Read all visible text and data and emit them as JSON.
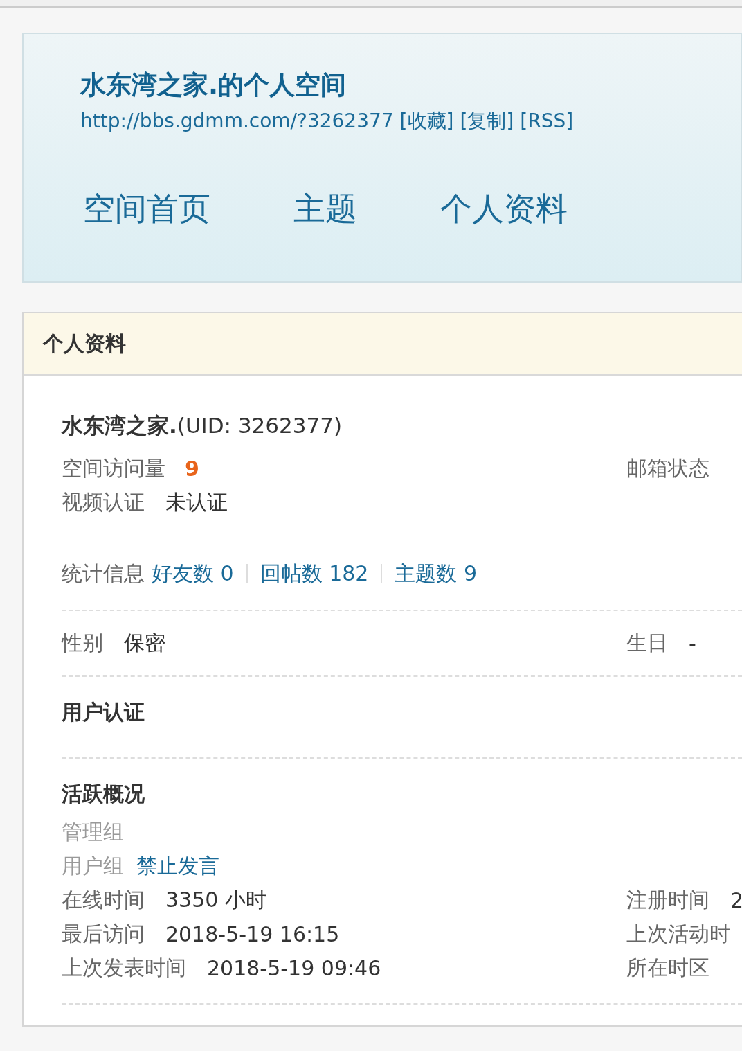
{
  "header": {
    "title": "水东湾之家.的个人空间",
    "url": "http://bbs.gdmm.com/?3262377",
    "links": [
      "[收藏]",
      "[复制]",
      "[RSS]"
    ],
    "nav": [
      {
        "label": "空间首页"
      },
      {
        "label": "主题"
      },
      {
        "label": "个人资料"
      }
    ]
  },
  "profile": {
    "heading": "个人资料",
    "name": "水东湾之家.",
    "uid": "(UID: 3262377)",
    "basic": [
      {
        "left": {
          "label": "空间访问量",
          "value": "9",
          "kind": "count"
        },
        "right": {
          "label": "邮箱状态"
        }
      },
      {
        "left": {
          "label": "视频认证",
          "value": "未认证",
          "kind": "plain"
        }
      }
    ],
    "stats": {
      "label": "统计信息",
      "links": [
        "好友数 0",
        "回帖数 182",
        "主题数 9"
      ]
    },
    "personal": [
      {
        "left": {
          "label": "性别",
          "value": "保密"
        },
        "right": {
          "label": "生日",
          "value": "-"
        }
      }
    ],
    "certification": {
      "title": "用户认证"
    },
    "activity": {
      "title": "活跃概况",
      "rows": [
        {
          "left": {
            "label": "管理组",
            "kind": "group"
          }
        },
        {
          "left": {
            "label": "用户组",
            "value": "禁止发言",
            "kind": "group-link"
          }
        },
        {
          "left": {
            "label": "在线时间",
            "value": "3350 小时",
            "kind": "plain"
          },
          "right": {
            "label": "注册时间",
            "value": "2"
          }
        },
        {
          "left": {
            "label": "最后访问",
            "value": "2018-5-19 16:15",
            "kind": "plain"
          },
          "right": {
            "label": "上次活动时"
          }
        },
        {
          "left": {
            "label": "上次发表时间",
            "value": "2018-5-19 09:46",
            "kind": "plain"
          },
          "right": {
            "label": "所在时区"
          }
        }
      ]
    }
  }
}
